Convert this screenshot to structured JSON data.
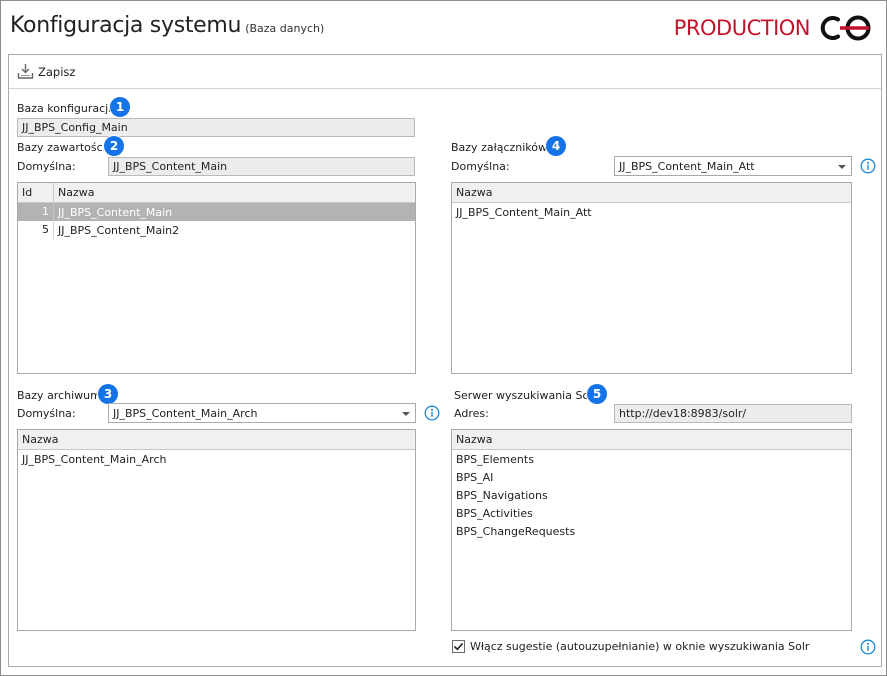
{
  "window": {
    "title": "Konfiguracja systemu",
    "subtitle": "(Baza danych)",
    "environment": "PRODUCTION"
  },
  "toolbar": {
    "save_label": "Zapisz"
  },
  "config_db": {
    "label": "Baza konfiguracji:",
    "badge": "1",
    "value": "JJ_BPS_Config_Main"
  },
  "content_db": {
    "label": "Bazy zawartości:",
    "badge": "2",
    "default_label": "Domyślna:",
    "default_value": "JJ_BPS_Content_Main",
    "columns": [
      "Id",
      "Nazwa"
    ],
    "rows": [
      {
        "id": "1",
        "name": "JJ_BPS_Content_Main",
        "selected": true
      },
      {
        "id": "5",
        "name": "JJ_BPS_Content_Main2",
        "selected": false
      }
    ]
  },
  "attachment_db": {
    "label": "Bazy załączników:",
    "badge": "4",
    "default_label": "Domyślna:",
    "default_value": "JJ_BPS_Content_Main_Att",
    "column": "Nazwa",
    "rows": [
      "JJ_BPS_Content_Main_Att"
    ]
  },
  "archive_db": {
    "label": "Bazy archiwum:",
    "badge": "3",
    "default_label": "Domyślna:",
    "default_value": "JJ_BPS_Content_Main_Arch",
    "column": "Nazwa",
    "rows": [
      "JJ_BPS_Content_Main_Arch"
    ]
  },
  "solr": {
    "label": "Serwer wyszukiwania Solr:",
    "badge": "5",
    "address_label": "Adres:",
    "address_value": "http://dev18:8983/solr/",
    "column": "Nazwa",
    "rows": [
      "BPS_Elements",
      "BPS_AI",
      "BPS_Navigations",
      "BPS_Activities",
      "BPS_ChangeRequests"
    ],
    "suggest_label": "Włącz sugestie (autouzupełnianie) w oknie wyszukiwania Solr",
    "suggest_checked": true
  },
  "icons": {
    "save": "save-download-icon",
    "info": "info-circle-icon",
    "logo": "production-logo-icon",
    "dropdown": "chevron-down-icon",
    "check": "checkmark-icon"
  },
  "colors": {
    "accent_badge": "#1473e6",
    "environment_red": "#c2142b",
    "selected_row": "#b3b3b3",
    "info_blue": "#1a8ad4"
  }
}
